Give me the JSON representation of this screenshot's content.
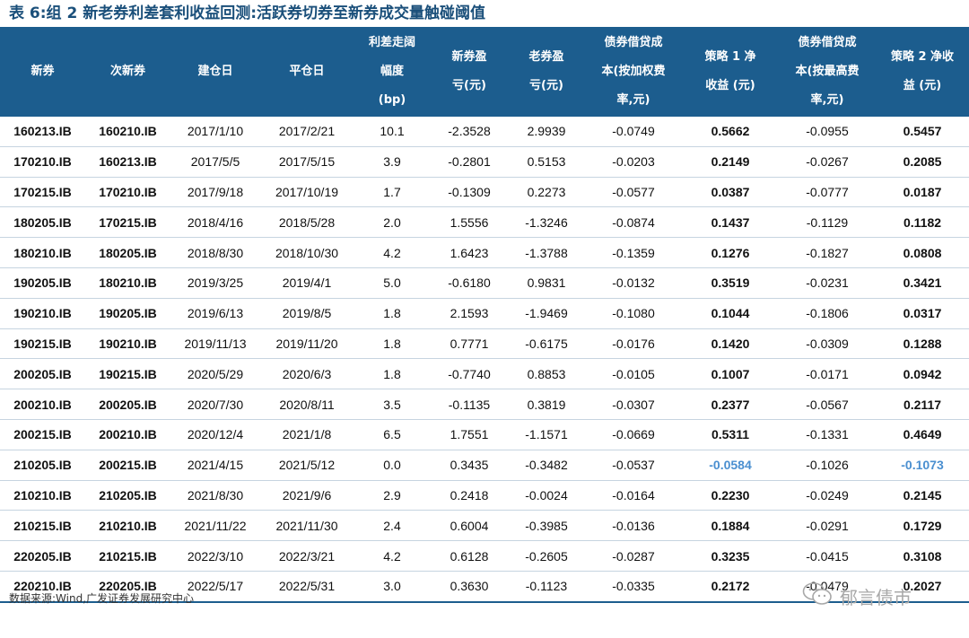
{
  "title": "表 6:组 2 新老券利差套利收益回测:活跃券切券至新券成交量触碰阈值",
  "headers": [
    "新券",
    "次新券",
    "建仓日",
    "平仓日",
    "利差走阔幅度(bp)",
    "新券盈亏(元)",
    "老券盈亏(元)",
    "债券借贷成本(按加权费率,元)",
    "策略 1 净收益 (元)",
    "债券借贷成本(按最高费率,元)",
    "策略 2 净收益 (元)"
  ],
  "header_lines": [
    [
      "新券"
    ],
    [
      "次新券"
    ],
    [
      "建仓日"
    ],
    [
      "平仓日"
    ],
    [
      "利差走阔",
      "幅度",
      "(bp)"
    ],
    [
      "新券盈",
      "亏(元)"
    ],
    [
      "老券盈",
      "亏(元)"
    ],
    [
      "债券借贷成",
      "本(按加权费",
      "率,元)"
    ],
    [
      "策略 1 净",
      "收益 (元)"
    ],
    [
      "债券借贷成",
      "本(按最高费",
      "率,元)"
    ],
    [
      "策略 2 净收",
      "益 (元)"
    ]
  ],
  "rows": [
    [
      "160213.IB",
      "160210.IB",
      "2017/1/10",
      "2017/2/21",
      "10.1",
      "-2.3528",
      "2.9939",
      "-0.0749",
      "0.5662",
      "-0.0955",
      "0.5457"
    ],
    [
      "170210.IB",
      "160213.IB",
      "2017/5/5",
      "2017/5/15",
      "3.9",
      "-0.2801",
      "0.5153",
      "-0.0203",
      "0.2149",
      "-0.0267",
      "0.2085"
    ],
    [
      "170215.IB",
      "170210.IB",
      "2017/9/18",
      "2017/10/19",
      "1.7",
      "-0.1309",
      "0.2273",
      "-0.0577",
      "0.0387",
      "-0.0777",
      "0.0187"
    ],
    [
      "180205.IB",
      "170215.IB",
      "2018/4/16",
      "2018/5/28",
      "2.0",
      "1.5556",
      "-1.3246",
      "-0.0874",
      "0.1437",
      "-0.1129",
      "0.1182"
    ],
    [
      "180210.IB",
      "180205.IB",
      "2018/8/30",
      "2018/10/30",
      "4.2",
      "1.6423",
      "-1.3788",
      "-0.1359",
      "0.1276",
      "-0.1827",
      "0.0808"
    ],
    [
      "190205.IB",
      "180210.IB",
      "2019/3/25",
      "2019/4/1",
      "5.0",
      "-0.6180",
      "0.9831",
      "-0.0132",
      "0.3519",
      "-0.0231",
      "0.3421"
    ],
    [
      "190210.IB",
      "190205.IB",
      "2019/6/13",
      "2019/8/5",
      "1.8",
      "2.1593",
      "-1.9469",
      "-0.1080",
      "0.1044",
      "-0.1806",
      "0.0317"
    ],
    [
      "190215.IB",
      "190210.IB",
      "2019/11/13",
      "2019/11/20",
      "1.8",
      "0.7771",
      "-0.6175",
      "-0.0176",
      "0.1420",
      "-0.0309",
      "0.1288"
    ],
    [
      "200205.IB",
      "190215.IB",
      "2020/5/29",
      "2020/6/3",
      "1.8",
      "-0.7740",
      "0.8853",
      "-0.0105",
      "0.1007",
      "-0.0171",
      "0.0942"
    ],
    [
      "200210.IB",
      "200205.IB",
      "2020/7/30",
      "2020/8/11",
      "3.5",
      "-0.1135",
      "0.3819",
      "-0.0307",
      "0.2377",
      "-0.0567",
      "0.2117"
    ],
    [
      "200215.IB",
      "200210.IB",
      "2020/12/4",
      "2021/1/8",
      "6.5",
      "1.7551",
      "-1.1571",
      "-0.0669",
      "0.5311",
      "-0.1331",
      "0.4649"
    ],
    [
      "210205.IB",
      "200215.IB",
      "2021/4/15",
      "2021/5/12",
      "0.0",
      "0.3435",
      "-0.3482",
      "-0.0537",
      "-0.0584",
      "-0.1026",
      "-0.1073"
    ],
    [
      "210210.IB",
      "210205.IB",
      "2021/8/30",
      "2021/9/6",
      "2.9",
      "0.2418",
      "-0.0024",
      "-0.0164",
      "0.2230",
      "-0.0249",
      "0.2145"
    ],
    [
      "210215.IB",
      "210210.IB",
      "2021/11/22",
      "2021/11/30",
      "2.4",
      "0.6004",
      "-0.3985",
      "-0.0136",
      "0.1884",
      "-0.0291",
      "0.1729"
    ],
    [
      "220205.IB",
      "210215.IB",
      "2022/3/10",
      "2022/3/21",
      "4.2",
      "0.6128",
      "-0.2605",
      "-0.0287",
      "0.3235",
      "-0.0415",
      "0.3108"
    ],
    [
      "220210.IB",
      "220205.IB",
      "2022/5/17",
      "2022/5/31",
      "3.0",
      "0.3630",
      "-0.1123",
      "-0.0335",
      "0.2172",
      "-0.0479",
      "0.2027"
    ]
  ],
  "source": "数据来源:Wind,广发证券发展研究中心",
  "watermark": {
    "text": "郁言债市",
    "icon": "wechat-icon"
  },
  "colors": {
    "header_bg": "#1c5d8e",
    "title": "#1a4f7a",
    "negative_highlight": "#4a8fd0",
    "row_divider": "#c6d4e0"
  }
}
